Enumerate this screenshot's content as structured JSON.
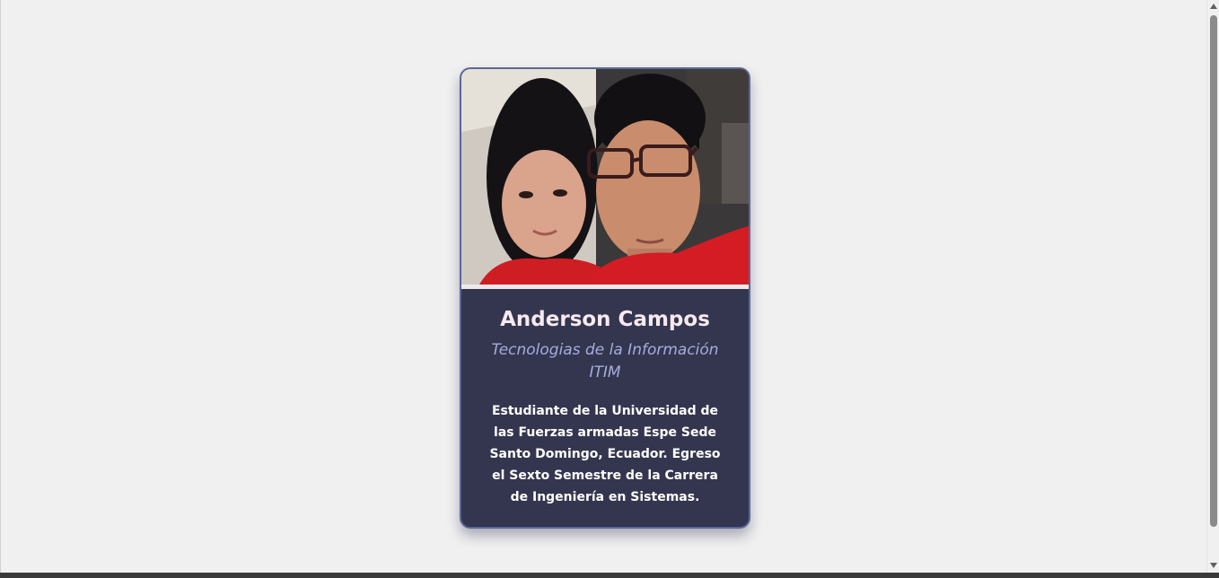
{
  "profile": {
    "photo_alt": "Anderson Campos",
    "name": "Anderson Campos",
    "subtitle_line1": "Tecnologias de la Información",
    "subtitle_line2": "ITIM",
    "description": "Estudiante de la Universidad de las Fuerzas armadas Espe Sede Santo Domingo, Ecuador. Egreso el Sexto Semestre de la Carrera de Ingeniería en Sistemas."
  },
  "colors": {
    "page_background": "#f0f0f0",
    "card_background": "#34364f",
    "card_border": "#5a6797",
    "name_color": "#f6e9ef",
    "subtitle_color": "#a6acdd",
    "description_color": "#ffffff"
  }
}
